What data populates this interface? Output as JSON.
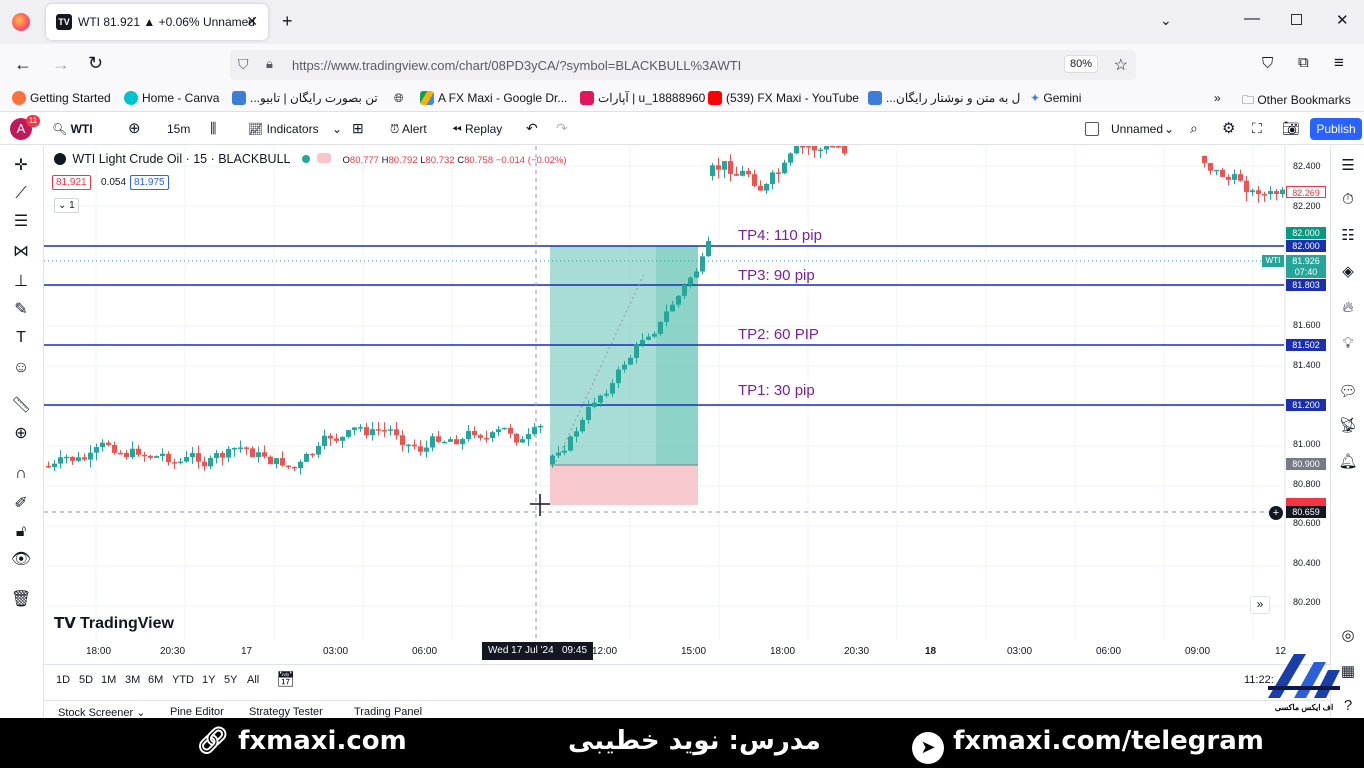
{
  "browser": {
    "tab_title": "WTI 81.921 ▲ +0.06% Unnamed",
    "tab_icon": "TV",
    "url": "https://www.tradingview.com/chart/08PD3yCA/?symbol=BLACKBULL%3AWTI",
    "zoom": "80%",
    "bookmarks": [
      "Getting Started",
      "Home - Canva",
      "...تن بصورت رایگان | تابیو",
      "A FX Maxi - Google Dr...",
      "آپارات | u_18888960",
      "(539) FX Maxi - YouTube",
      "...ل به متن و نوشتار رایگان",
      "Gemini"
    ],
    "other_bookmarks": "Other Bookmarks"
  },
  "toolbar": {
    "avatar": "A",
    "avatar_badge": "11",
    "symbol": "WTI",
    "interval": "15m",
    "indicators": "Indicators",
    "alert": "Alert",
    "replay": "Replay",
    "layout_name": "Unnamed",
    "publish": "Publish"
  },
  "legend": {
    "title": "WTI Light Crude Oil · 15 · BLACKBULL",
    "o_label": "O",
    "o": "80.777",
    "h_label": "H",
    "h": "80.792",
    "l_label": "L",
    "l": "80.732",
    "c_label": "C",
    "c": "80.758",
    "change": "−0.014 (−0.02%)",
    "sell": "81.921",
    "spread": "0.054",
    "buy": "81.975",
    "collapse": "1"
  },
  "tp_labels": {
    "tp4": "TP4: 110 pip",
    "tp3": "TP3: 90 pip",
    "tp2": "TP2: 60 PIP",
    "tp1": "TP1: 30 pip"
  },
  "price_labels": {
    "p82269": "82.269",
    "p82000a": "82.000",
    "p82000b": "82.000",
    "wti_tag": "WTI",
    "p81926": "81.926",
    "countdown": "07:40",
    "p81803": "81.803",
    "p81502": "81.502",
    "p81200": "81.200",
    "p80900": "80.900",
    "p80659": "80.659"
  },
  "y_axis": [
    "82.400",
    "82.200",
    "81.600",
    "81.400",
    "81.000",
    "80.800",
    "80.600",
    "80.400",
    "80.200"
  ],
  "x_axis": [
    "18:00",
    "20:30",
    "17",
    "03:00",
    "06:00",
    "12:00",
    "15:00",
    "18:00",
    "20:30",
    "18",
    "03:00",
    "06:00",
    "09:00",
    "12"
  ],
  "crosshair_date": "Wed 17 Jul '24",
  "crosshair_time": "09:45",
  "watermark": "TradingView",
  "ranges": [
    "1D",
    "5D",
    "1M",
    "3M",
    "6M",
    "YTD",
    "1Y",
    "5Y",
    "All"
  ],
  "clock": "11:22:",
  "bottom_tabs": [
    "Stock Screener",
    "Pine Editor",
    "Strategy Tester",
    "Trading Panel"
  ],
  "banner": {
    "site": "fxmaxi.com",
    "teacher": "مدرس: نوید خطیبی",
    "telegram": "fxmaxi.com/telegram",
    "logo_text": "اف ایکس ماکسی"
  },
  "colors": {
    "tp_line": "#1a2fb0",
    "tp_text": "#7b1fa2",
    "up": "#26a69a",
    "down": "#ef5350",
    "profit": "#5fc1b0",
    "loss": "#f8c8cf",
    "accent": "#2962ff"
  }
}
